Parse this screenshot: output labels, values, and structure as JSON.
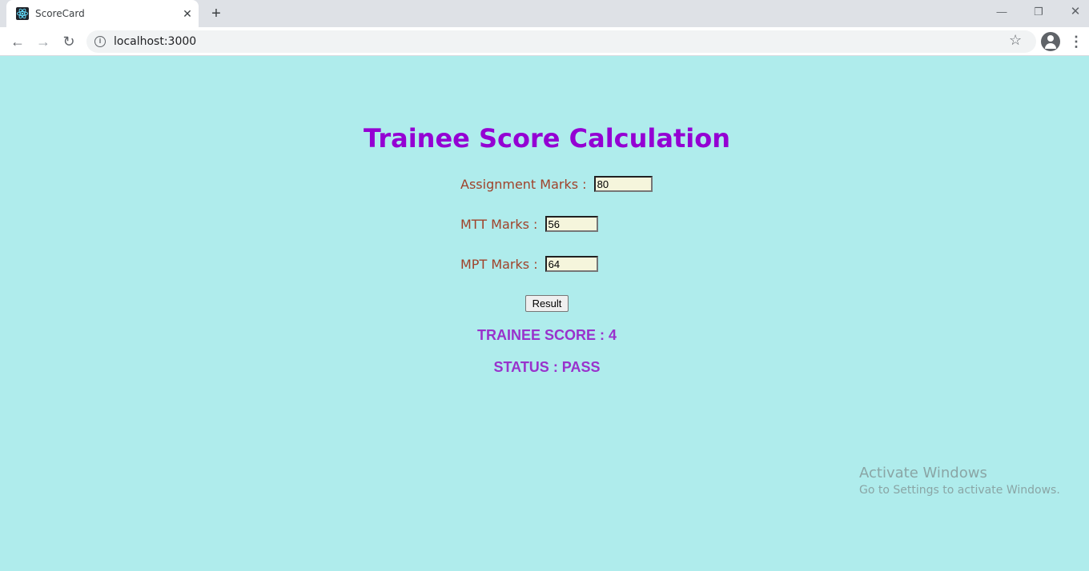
{
  "browser": {
    "tab_title": "ScoreCard",
    "url": "localhost:3000"
  },
  "page": {
    "title": "Trainee Score Calculation",
    "fields": [
      {
        "label": "Assignment Marks : ",
        "value": "80"
      },
      {
        "label": "MTT Marks : ",
        "value": "56"
      },
      {
        "label": "MPT Marks : ",
        "value": "64"
      }
    ],
    "result_button": "Result",
    "score_text": "TRAINEE SCORE : 4",
    "status_text": "STATUS : PASS"
  },
  "watermark": {
    "title": "Activate Windows",
    "subtitle": "Go to Settings to activate Windows."
  },
  "colors": {
    "background": "#afecec",
    "title": "#9400d3",
    "label": "#a0422a",
    "result_text": "#9932cc",
    "input_bg": "#f5f5dc"
  }
}
